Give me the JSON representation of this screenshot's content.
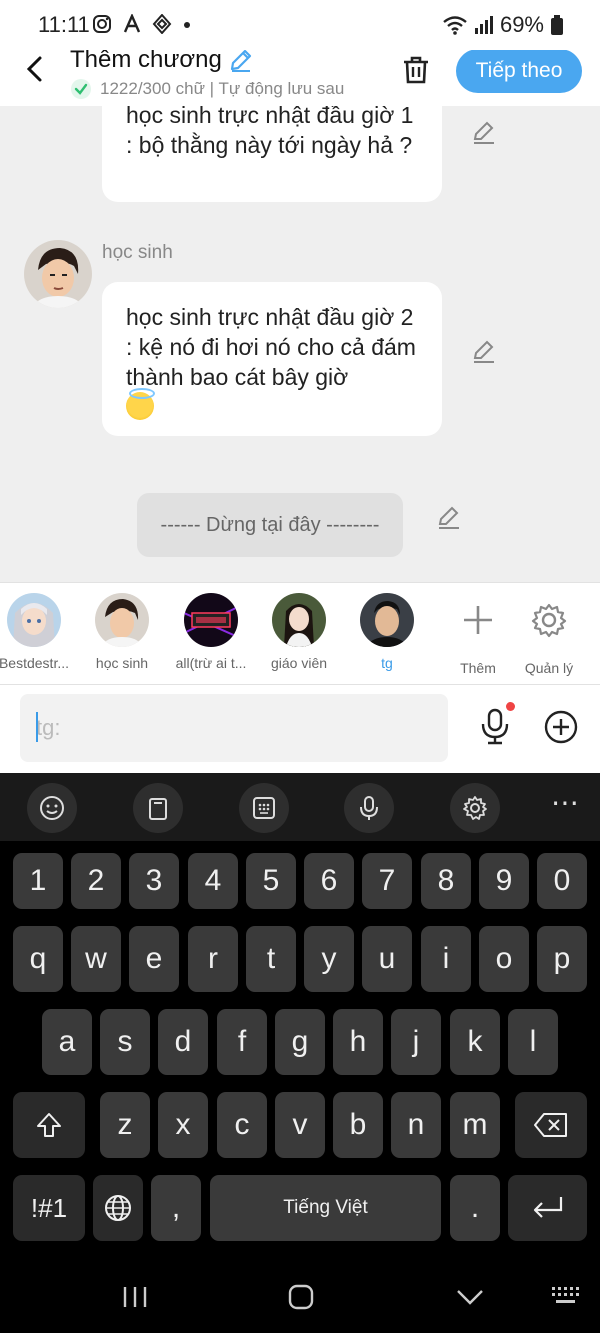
{
  "status_bar": {
    "time": "11:11",
    "battery_percent": "69%",
    "left_icons": [
      "instagram-icon",
      "app-a-icon",
      "app-b-icon",
      "dot-icon"
    ],
    "right_icons": [
      "wifi-icon",
      "signal-icon",
      "battery-icon"
    ]
  },
  "header": {
    "title": "Thêm chương",
    "subtitle": "1222/300 chữ | Tự động lưu sau",
    "next_label": "Tiếp theo"
  },
  "chat": {
    "messages": [
      {
        "text": "học sinh trực nhật đầu giờ 1 : bộ thằng này tới ngày hả ?"
      },
      {
        "sender": "học sinh",
        "text": "học sinh trực nhật đầu giờ 2 : kệ nó đi hơi nó cho cả đám thành bao cát bây giờ"
      }
    ],
    "stop_text": "------ Dừng tại đây --------"
  },
  "characters": [
    {
      "name": "Bestdestr..."
    },
    {
      "name": "học sinh"
    },
    {
      "name": "all(trừ ai t..."
    },
    {
      "name": "giáo viên"
    },
    {
      "name": "tg"
    },
    {
      "name": "Thêm"
    },
    {
      "name": "Quản lý"
    }
  ],
  "input": {
    "placeholder": "tg:",
    "value": ""
  },
  "keyboard": {
    "number_row": [
      "1",
      "2",
      "3",
      "4",
      "5",
      "6",
      "7",
      "8",
      "9",
      "0"
    ],
    "row1": [
      "q",
      "w",
      "e",
      "r",
      "t",
      "y",
      "u",
      "i",
      "o",
      "p"
    ],
    "row2": [
      "a",
      "s",
      "d",
      "f",
      "g",
      "h",
      "j",
      "k",
      "l"
    ],
    "row3": [
      "z",
      "x",
      "c",
      "v",
      "b",
      "n",
      "m"
    ],
    "symbols_label": "!#1",
    "comma": ",",
    "space_label": "Tiếng Việt",
    "period": "."
  },
  "colors": {
    "accent": "#4aa7f0",
    "active_name": "#3a9be8",
    "check_green": "#2fbf71"
  }
}
